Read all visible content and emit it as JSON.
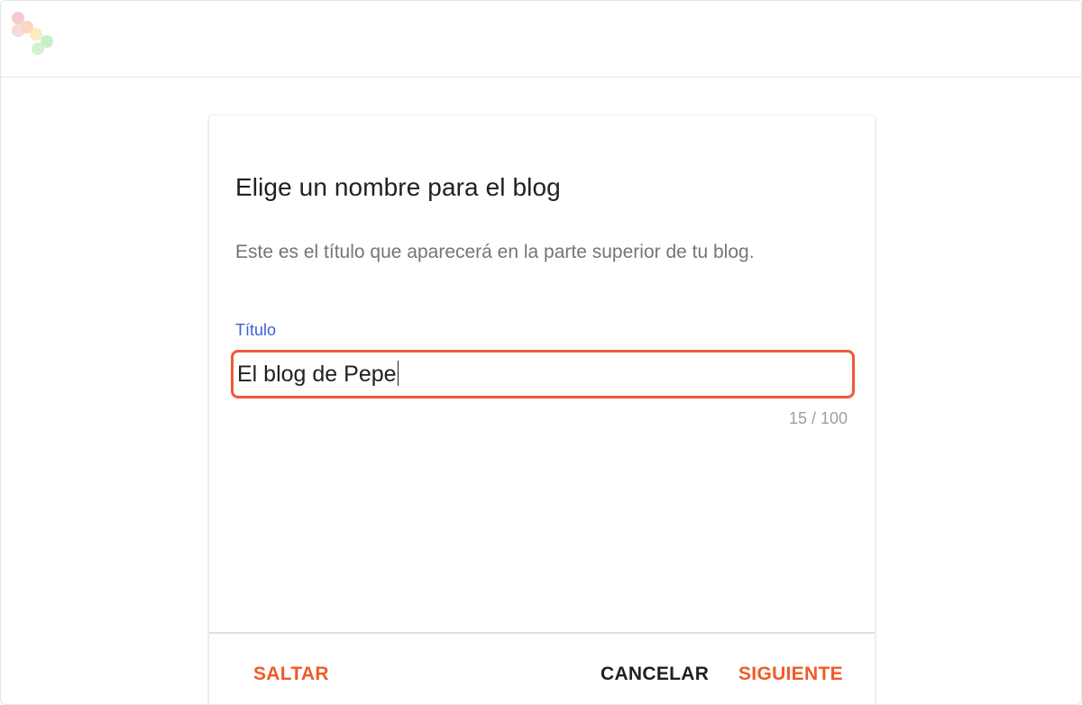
{
  "dialog": {
    "title": "Elige un nombre para el blog",
    "subtitle": "Este es el título que aparecerá en la parte superior de tu blog.",
    "field_label": "Título",
    "field_value": "El blog de Pepe",
    "char_counter": "15 / 100",
    "skip_label": "SALTAR",
    "cancel_label": "CANCELAR",
    "next_label": "SIGUIENTE"
  },
  "colors": {
    "accent": "#f05a28",
    "label_blue": "#3d5fd1",
    "highlight_border": "#f05a38"
  }
}
